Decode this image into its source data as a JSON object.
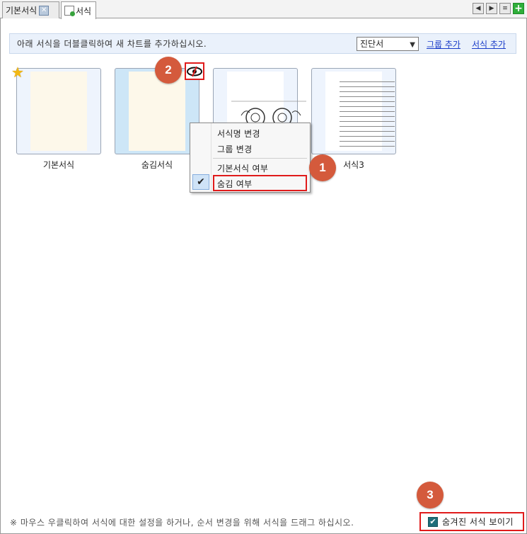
{
  "tabs": [
    {
      "label": "기본서식"
    },
    {
      "label": "서식"
    }
  ],
  "toolbar": {
    "instruction": "아래 서식을 더블클릭하여 새 차트를 추가하십시오.",
    "category_select": "진단서",
    "add_group_link": "그룹 추가",
    "add_form_link": "서식 추가"
  },
  "forms": [
    {
      "label": "기본서식"
    },
    {
      "label": "숨김서식"
    },
    {
      "label": ""
    },
    {
      "label": "서식3"
    }
  ],
  "context_menu": {
    "items": [
      "서식명 변경",
      "그룹 변경",
      "기본서식 여부",
      "숨김 여부"
    ]
  },
  "badges": [
    "1",
    "2",
    "3"
  ],
  "footer": {
    "hint": "※ 마우스 우클릭하여 서식에 대한 설정을 하거나, 순서 변경을 위해 서식을 드래그 하십시오.",
    "show_hidden_label": "숨겨진 서식 보이기"
  },
  "colors": {
    "accent_red": "#e01b1b",
    "badge": "#d45a3c",
    "link": "#1a3cc9"
  }
}
